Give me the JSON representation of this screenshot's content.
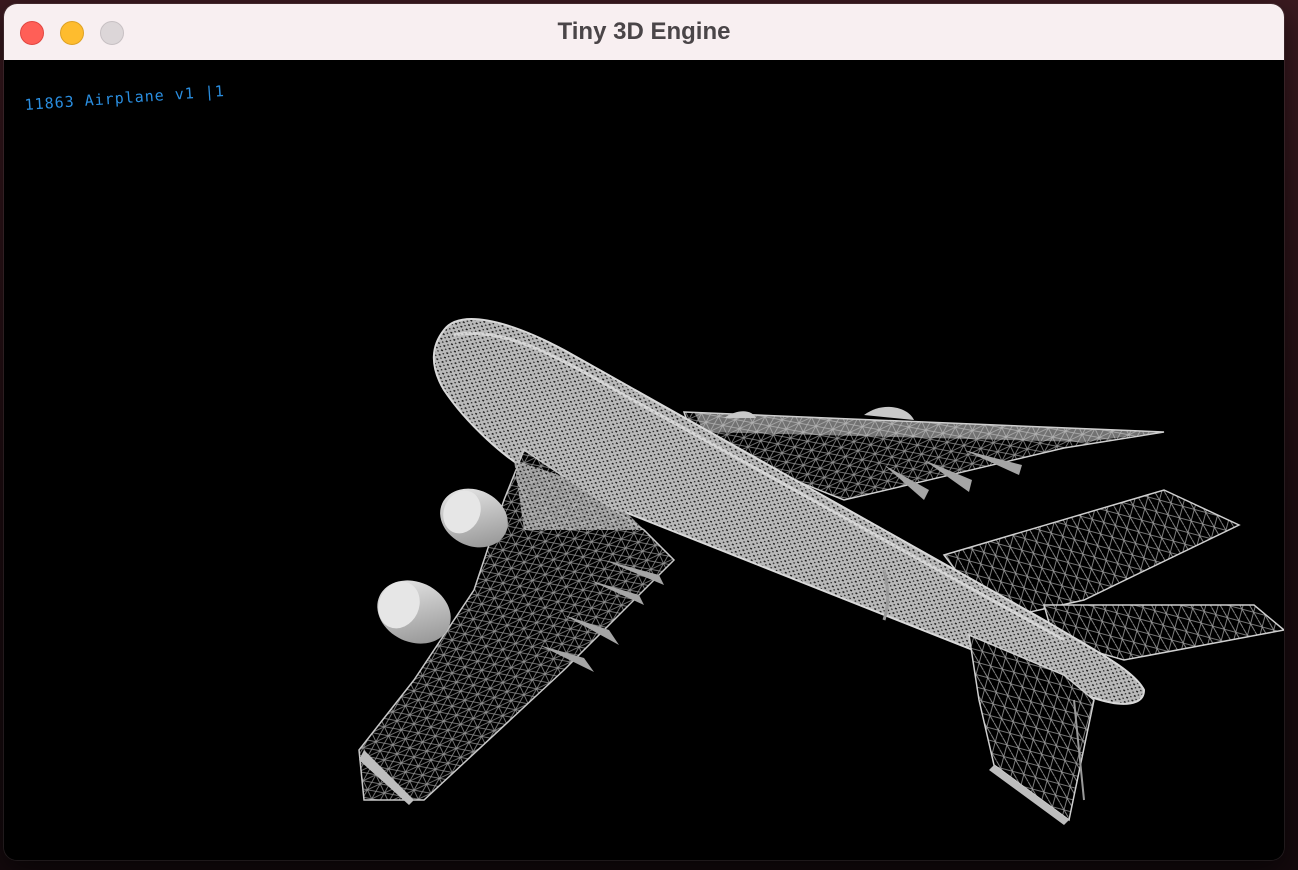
{
  "window": {
    "title": "Tiny 3D Engine",
    "controls": [
      "close",
      "minimize",
      "zoom"
    ]
  },
  "viewport": {
    "overlay_text": "11863 Airplane v1 |1",
    "background_color": "#000000",
    "overlay_color": "#2a8ee0",
    "model": "airplane wireframe render"
  }
}
